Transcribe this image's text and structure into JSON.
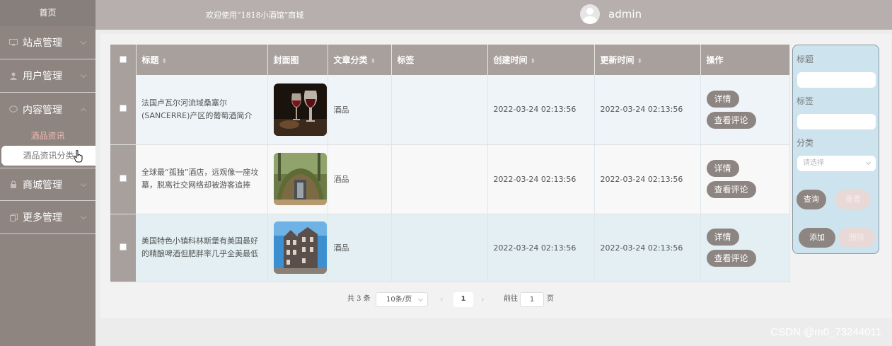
{
  "sidebar": {
    "home": "首页",
    "items": [
      {
        "label": "站点管理",
        "icon": "monitor-icon"
      },
      {
        "label": "用户管理",
        "icon": "user-icon"
      },
      {
        "label": "内容管理",
        "icon": "chat-icon"
      }
    ],
    "sub_items": [
      "酒品资讯",
      "酒品资讯分类"
    ],
    "items_after": [
      {
        "label": "商城管理",
        "icon": "lock-icon"
      },
      {
        "label": "更多管理",
        "icon": "copy-icon"
      }
    ]
  },
  "header": {
    "welcome": "欢迎使用“1818小酒馆”商城",
    "username": "admin"
  },
  "table": {
    "columns": [
      "标题",
      "封面图",
      "文章分类",
      "标签",
      "创建时间",
      "更新时间",
      "操作"
    ],
    "rows": [
      {
        "title": "法国卢瓦尔河流域桑塞尔(SANCERRE)产区的葡萄酒简介",
        "category": "酒品",
        "tag": "",
        "created": "2022-03-24 02:13:56",
        "updated": "2022-03-24 02:13:56"
      },
      {
        "title": "全球最“孤独”酒店，远观像一座坟墓，脱离社交网络却被游客追捧",
        "category": "酒品",
        "tag": "",
        "created": "2022-03-24 02:13:56",
        "updated": "2022-03-24 02:13:56"
      },
      {
        "title": "美国特色小镇科林斯堡有美国最好的精酿啤酒但肥胖率几乎全美最低",
        "category": "酒品",
        "tag": "",
        "created": "2022-03-24 02:13:56",
        "updated": "2022-03-24 02:13:56"
      }
    ],
    "btn_detail": "详情",
    "btn_comments": "查看评论"
  },
  "filter": {
    "title_label": "标题",
    "tag_label": "标签",
    "category_label": "分类",
    "category_placeholder": "请选择",
    "query": "查询",
    "reset": "重置",
    "add": "添加",
    "delete": "删除"
  },
  "pagination": {
    "total": "共 3 条",
    "page_size": "10条/页",
    "current_page": "1",
    "goto_label": "前往",
    "goto_value": "1",
    "page_unit": "页"
  },
  "watermark": "CSDN @m0_73244011",
  "colors": {
    "sidebar": "#8e8581",
    "header": "#b7afad",
    "accent_button": "#8d8581",
    "filter_panel": "#cde3ee"
  }
}
